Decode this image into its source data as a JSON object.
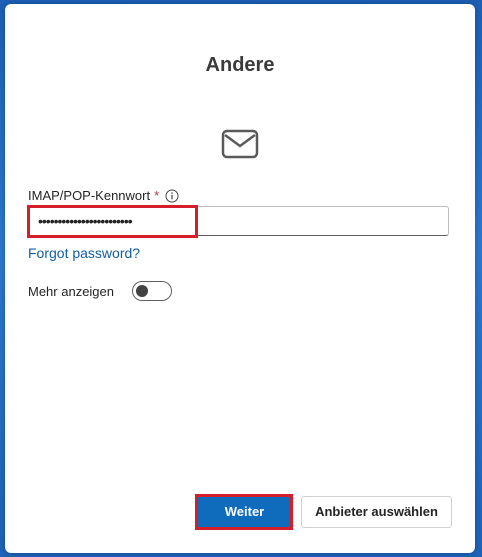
{
  "dialog": {
    "title": "Andere",
    "icon": "envelope-icon"
  },
  "password_field": {
    "label": "IMAP/POP-Kennwort",
    "required_marker": "*",
    "info_icon": "info-icon",
    "value": "••••••••••••••••••••••••"
  },
  "forgot_link": "Forgot password?",
  "show_more": {
    "label": "Mehr anzeigen",
    "enabled": false
  },
  "buttons": {
    "primary_label": "Weiter",
    "secondary_label": "Anbieter auswählen"
  },
  "colors": {
    "accent": "#0f6cbd",
    "link": "#115ea3",
    "highlight": "#d41f2b",
    "required": "#c4314b"
  }
}
